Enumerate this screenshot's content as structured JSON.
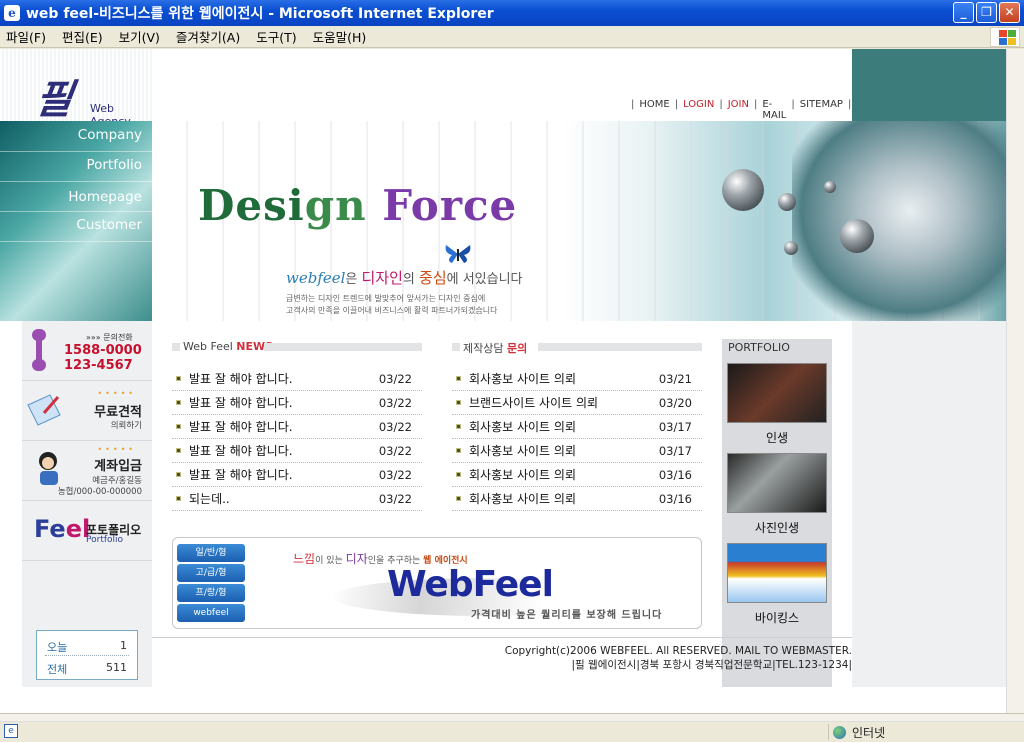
{
  "window": {
    "title": "web feel-비즈니스를 위한 웹에이전시 - Microsoft Internet Explorer",
    "minimize": "_",
    "restore": "❐",
    "close": "✕"
  },
  "menubar": {
    "items": [
      "파일(F)",
      "편집(E)",
      "보기(V)",
      "즐겨찾기(A)",
      "도구(T)",
      "도움말(H)"
    ]
  },
  "site": {
    "logo_mark": "필",
    "logo_sub": "Web Agency",
    "topnav": [
      {
        "label": "HOME",
        "highlight": false
      },
      {
        "label": "LOGIN",
        "highlight": true
      },
      {
        "label": "JOIN",
        "highlight": true
      },
      {
        "label": "E-MAIL",
        "highlight": false
      },
      {
        "label": "SITEMAP",
        "highlight": false
      }
    ],
    "sidenav": [
      "Company",
      "Portfolio",
      "Homepage",
      "Customer"
    ],
    "hero": {
      "title_part1": "Desi",
      "title_part2": "gn",
      "title_part3": "Force",
      "tag_brand": "webfeel",
      "tag_text1": "은 ",
      "tag_pink1": "디자인",
      "tag_text2": "의 ",
      "tag_pink2": "중심",
      "tag_text3": "에 서있습니다",
      "desc_line1": "급변하는 디자인 트렌드에 발맞추어 앞서가는 디자인 중심에",
      "desc_line2": "고객사의 만족을 이끌어내 비즈니스에 활력 파트너가되겠습니다"
    },
    "left": {
      "phone_label": "»»» 문의전화",
      "phone_line1": "1588-0000",
      "phone_line2": "123-4567",
      "quote_title": "무료견적",
      "quote_sub": "의뢰하기",
      "bank_title": "계좌입금",
      "bank_sub1": "예금주/홍길동",
      "bank_sub2": "농협/000-00-000000",
      "feel_f": "Fe",
      "feel_e": "el",
      "pf_ko": "포토폴리오",
      "pf_en": "Portfolio",
      "counter_today_label": "오늘",
      "counter_today_value": "1",
      "counter_total_label": "전체",
      "counter_total_value": "511"
    },
    "news": {
      "title_prefix": "Web Feel ",
      "title_accent": "NEWS",
      "items": [
        {
          "title": "발표 잘 해야 합니다.",
          "date": "03/22"
        },
        {
          "title": "발표 잘 해야 합니다.",
          "date": "03/22"
        },
        {
          "title": "발표 잘 해야 합니다.",
          "date": "03/22"
        },
        {
          "title": "발표 잘 해야 합니다.",
          "date": "03/22"
        },
        {
          "title": "발표 잘 해야 합니다.",
          "date": "03/22"
        },
        {
          "title": "되는데..",
          "date": "03/22"
        }
      ]
    },
    "inquiry": {
      "title_prefix": "제작상담 ",
      "title_accent": "문의",
      "items": [
        {
          "title": "회사홍보 사이트 의뢰",
          "date": "03/21"
        },
        {
          "title": "브랜드사이트 사이트 의뢰",
          "date": "03/20"
        },
        {
          "title": "회사홍보 사이트 의뢰",
          "date": "03/17"
        },
        {
          "title": "회사홍보 사이트 의뢰",
          "date": "03/17"
        },
        {
          "title": "회사홍보 사이트 의뢰",
          "date": "03/16"
        },
        {
          "title": "회사홍보 사이트 의뢰",
          "date": "03/16"
        }
      ]
    },
    "portfolio": {
      "heading": "PORTFOLIO",
      "items": [
        "인생",
        "사진인생",
        "바이킹스"
      ]
    },
    "banner": {
      "buttons": [
        "일/반/형",
        "고/급/형",
        "프/랑/형",
        "webfeel"
      ],
      "line1_r": "느낌",
      "line1_a": "이 있는 ",
      "line1_p": "디자",
      "line1_b": "인을 추구하는 ",
      "line1_o": "웹 에이전시",
      "big": "WebFeel",
      "line2": "가격대비 높은 퀄리티를 보장해 드립니다"
    },
    "copyright": {
      "line1": "Copyright(c)2006 WEBFEEL. All RESERVED. MAIL TO WEBMASTER.",
      "line2": "|필 웹에이전시|경북 포항시 경북직업전문학교|TEL.123-1234|"
    }
  },
  "statusbar": {
    "zone": "인터넷"
  },
  "colors": {
    "teal": "#3c7d7c",
    "accent_red": "#c0202a",
    "brand_blue": "#1d2a9c"
  }
}
